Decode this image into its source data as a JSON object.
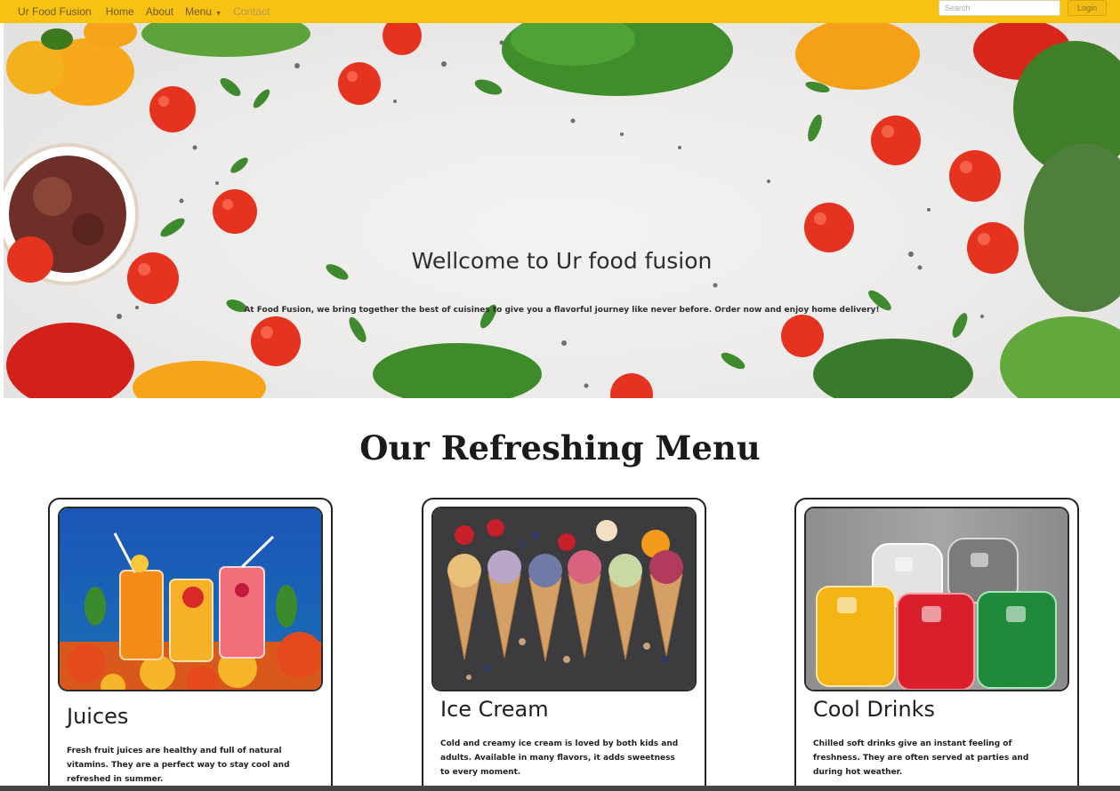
{
  "navbar": {
    "brand": "Ur Food Fusion",
    "links": [
      {
        "label": "Home"
      },
      {
        "label": "About"
      },
      {
        "label": "Menu"
      },
      {
        "label": "Contact"
      }
    ],
    "search_placeholder": "Search",
    "login_label": "Login",
    "colors": {
      "background": "#f8c212"
    }
  },
  "hero": {
    "title": "Wellcome to Ur food fusion",
    "text": "At Food Fusion, we bring together the best of cuisines to give you a flavorful journey like never before. Order now and enjoy home delivery!"
  },
  "menu": {
    "heading": "Our Refreshing Menu",
    "cards": [
      {
        "title": "Juices",
        "image": "juices-photo",
        "text": "Fresh fruit juices are healthy and full of natural vitamins. They are a perfect way to stay cool and refreshed in summer."
      },
      {
        "title": "Ice Cream",
        "image": "ice-cream-cones-photo",
        "text": "Cold and creamy ice cream is loved by both kids and adults. Available in many flavors, it adds sweetness to every moment."
      },
      {
        "title": "Cool Drinks",
        "image": "cool-drinks-photo",
        "text": "Chilled soft drinks give an instant feeling of freshness. They are often served at parties and during hot weather."
      }
    ]
  }
}
